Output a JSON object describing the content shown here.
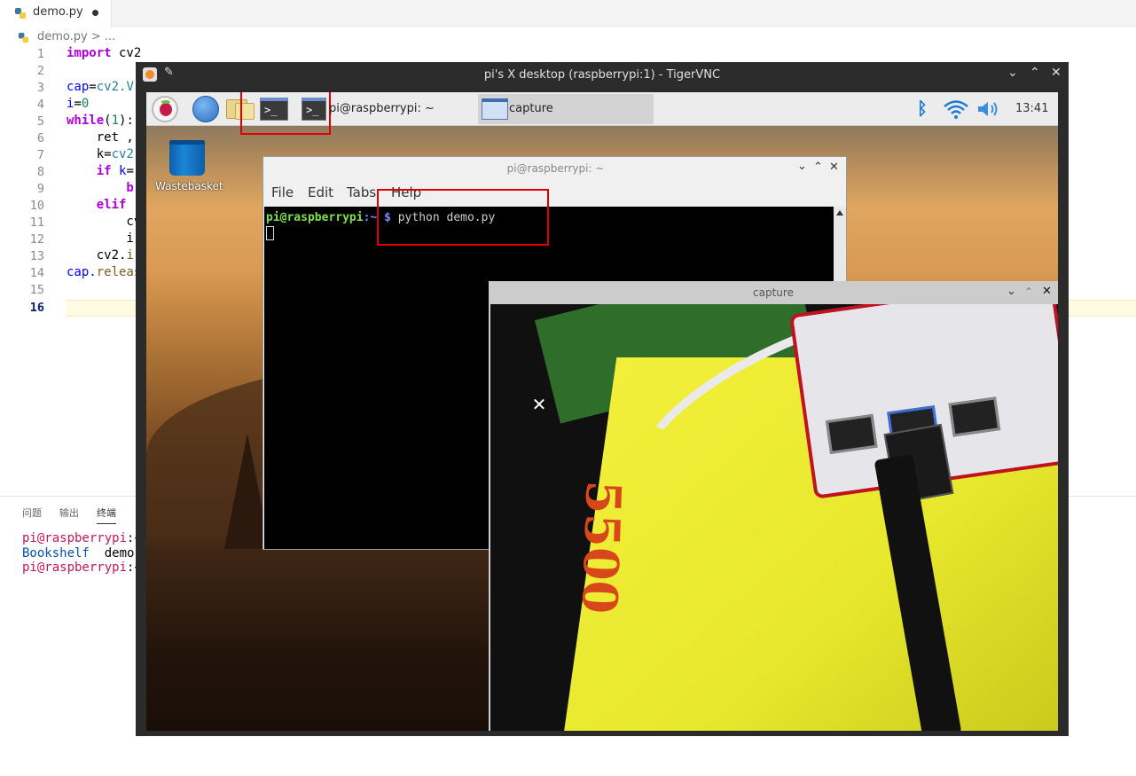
{
  "editor": {
    "tab_name": "demo.py",
    "breadcrumb": "demo.py > ...",
    "gutter": [
      "1",
      "2",
      "3",
      "4",
      "5",
      "6",
      "7",
      "8",
      "9",
      "10",
      "11",
      "12",
      "13",
      "14",
      "15",
      "16"
    ],
    "lines": {
      "l1a": "import",
      "l1b": " cv2",
      "l3a": "cap",
      "l3b": "=",
      "l3c": "cv2.V",
      "l4a": "i",
      "l4b": "=",
      "l4c": "0",
      "l5a": "while",
      "l5b": "(",
      "l5c": "1",
      "l5d": "):",
      "l6": "    ret ,",
      "l7a": "    k",
      "l7b": "=",
      "l7c": "cv2",
      "l8a": "    if ",
      "l8b": "k",
      "l8c": "=",
      "l9a": "        b",
      "l10a": "    elif ",
      "l11": "        cv",
      "l12": "        i",
      "l13a": "    cv2.",
      "l13b": "i",
      "l14a": "cap.",
      "l14b": "releas"
    }
  },
  "panel": {
    "tabs": [
      "问题",
      "输出",
      "终端"
    ],
    "term_lines": [
      {
        "user": "pi@raspberrypi",
        "rest": ":~"
      },
      {
        "user": "Bookshelf",
        "rest": "  demo."
      },
      {
        "user": "pi@raspberrypi",
        "rest": ":~"
      }
    ]
  },
  "vnc": {
    "title": "pi's X desktop (raspberrypi:1) - TigerVNC",
    "clock": "13:41",
    "task1_label": "pi@raspberrypi: ~",
    "task2_label": "capture",
    "term_icon_glyph": ">_",
    "wastebasket_label": "Wastebasket",
    "terminal": {
      "title": "pi@raspberrypi: ~",
      "menu": [
        "File",
        "Edit",
        "Tabs",
        "Help"
      ],
      "prompt_user": "pi@raspberrypi",
      "prompt_path": ":~",
      "prompt_sym": "$",
      "command": " python demo.py"
    },
    "capture": {
      "title": "capture",
      "book_text": "5500"
    }
  },
  "colors": {
    "highlight": "#e00000",
    "vscode_keyword": "#af00db",
    "terminal_green": "#7ee04a"
  }
}
